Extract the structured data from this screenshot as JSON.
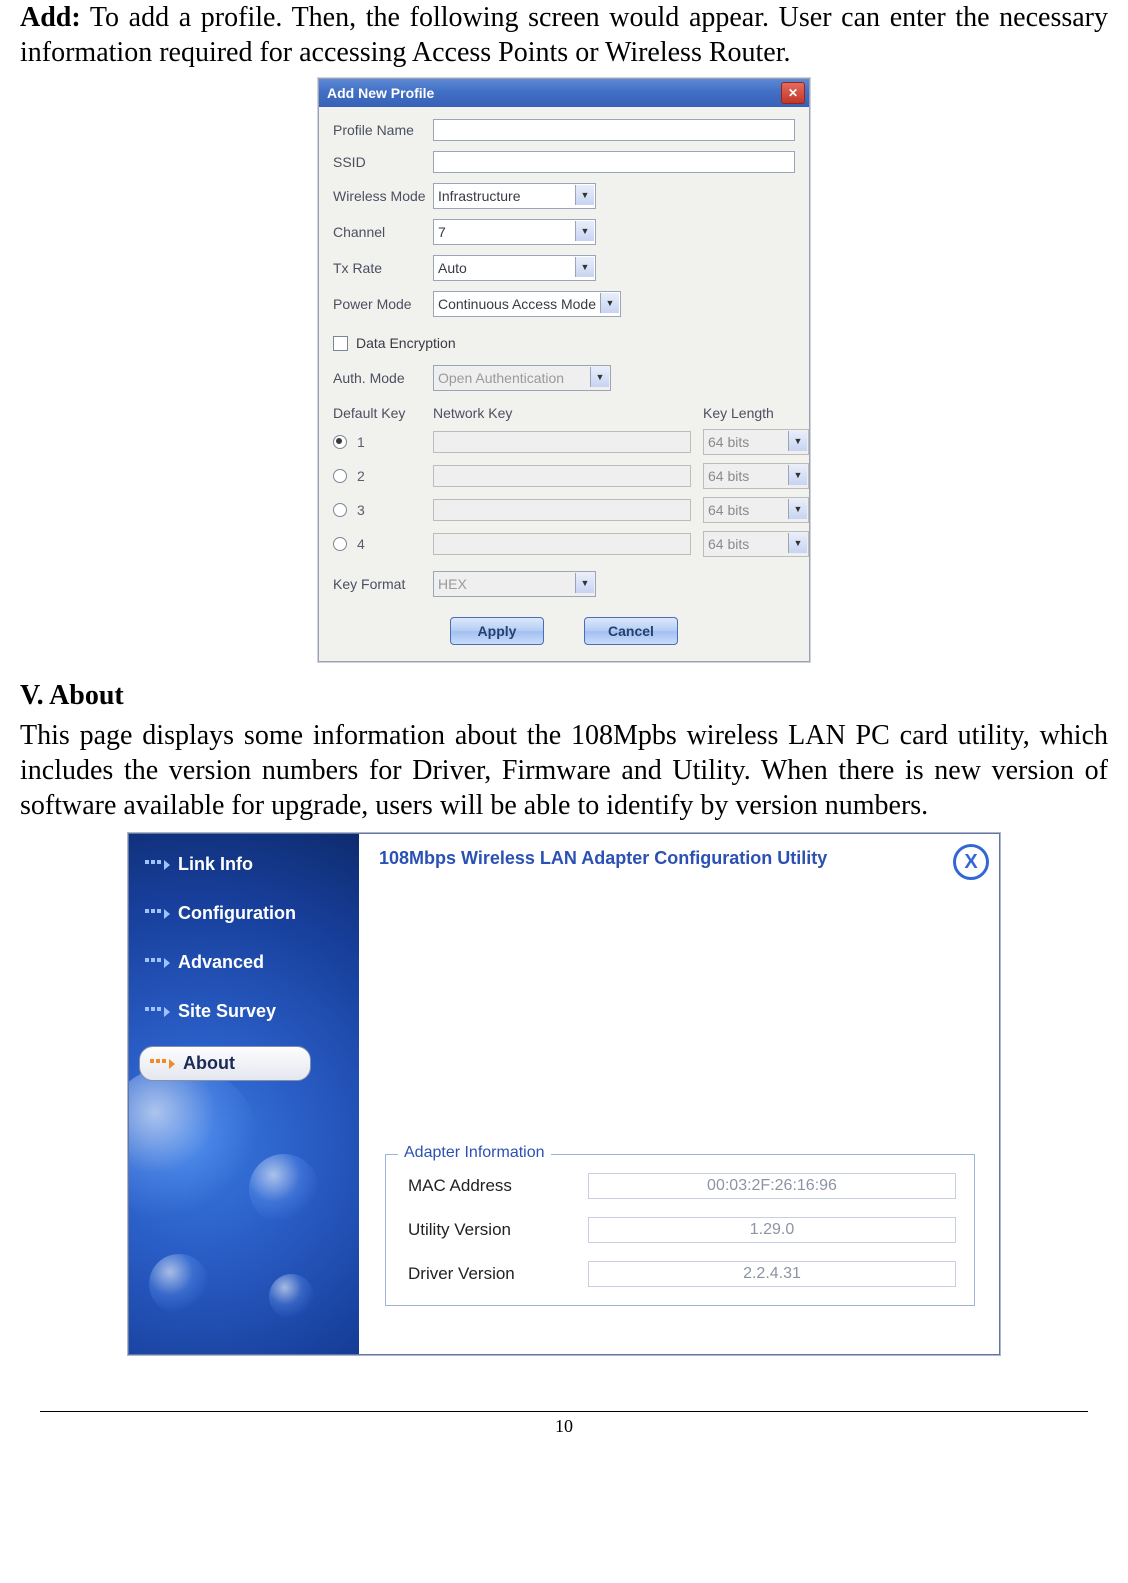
{
  "doc": {
    "para1_lead": "Add:",
    "para1_rest": " To add a profile. Then, the following screen would appear. User can enter the necessary information required for accessing Access Points or Wireless Router.",
    "heading2": "V. About",
    "para2": "This page displays some information about the  108Mpbs wireless LAN PC card utility, which includes the version numbers for Driver, Firmware and Utility.  When there is new version of software available for upgrade, users will be able to identify by version numbers.",
    "page_number": "10"
  },
  "dlg": {
    "title": "Add New Profile",
    "labels": {
      "profile_name": "Profile Name",
      "ssid": "SSID",
      "wireless_mode": "Wireless Mode",
      "channel": "Channel",
      "tx_rate": "Tx Rate",
      "power_mode": "Power Mode",
      "data_encryption": "Data Encryption",
      "auth_mode": "Auth. Mode",
      "default_key": "Default Key",
      "network_key": "Network Key",
      "key_length": "Key Length",
      "key_format": "Key Format"
    },
    "values": {
      "wireless_mode": "Infrastructure",
      "channel": "7",
      "tx_rate": "Auto",
      "power_mode": "Continuous Access Mode",
      "auth_mode": "Open Authentication",
      "key_format": "HEX",
      "key_length": "64 bits"
    },
    "keys": [
      "1",
      "2",
      "3",
      "4"
    ],
    "buttons": {
      "apply": "Apply",
      "cancel": "Cancel"
    }
  },
  "util": {
    "title": "108Mbps Wireless LAN Adapter Configuration Utility",
    "nav": {
      "link_info": "Link Info",
      "configuration": "Configuration",
      "advanced": "Advanced",
      "site_survey": "Site Survey",
      "about": "About"
    },
    "fieldset_title": "Adapter Information",
    "info": {
      "mac_label": "MAC Address",
      "mac_value": "00:03:2F:26:16:96",
      "utility_label": "Utility Version",
      "utility_value": "1.29.0",
      "driver_label": "Driver Version",
      "driver_value": "2.2.4.31"
    }
  }
}
